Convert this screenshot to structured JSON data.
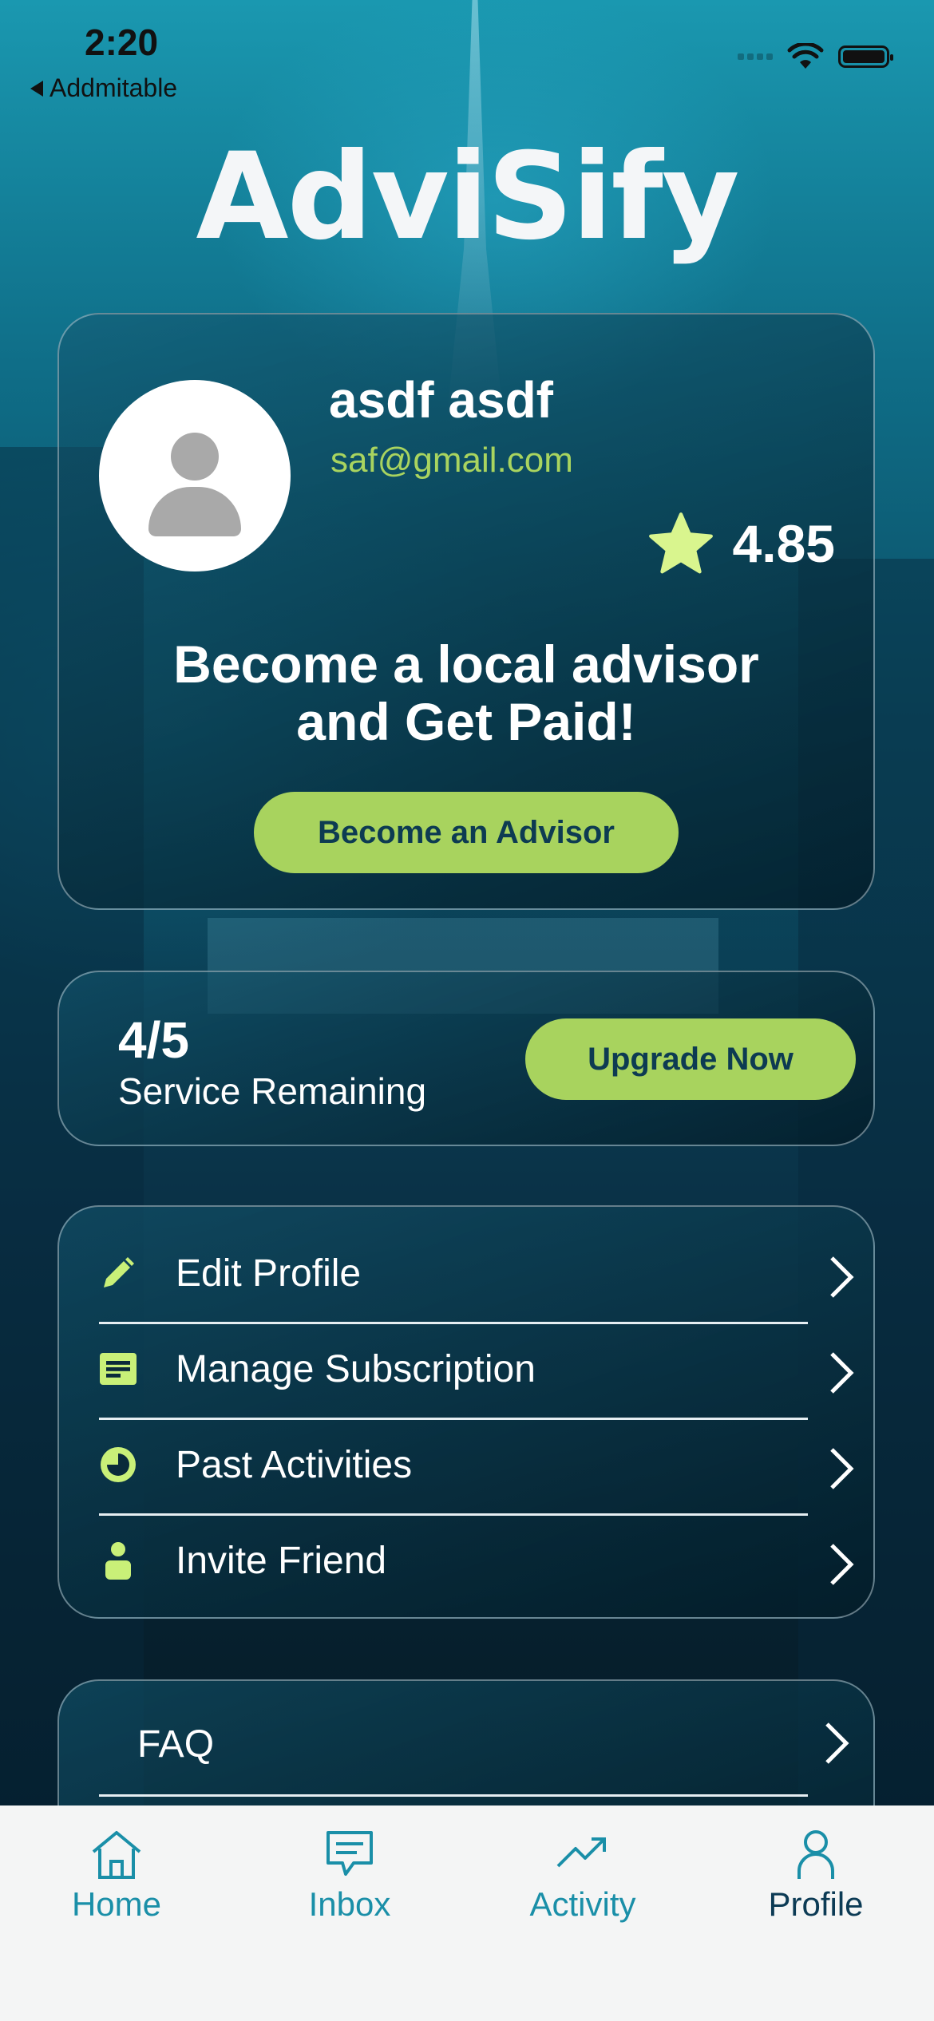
{
  "status_bar": {
    "time": "2:20",
    "back_label": "Addmitable"
  },
  "logo": {
    "text": "AdviSify"
  },
  "profile": {
    "name": "asdf asdf",
    "email": "saf@gmail.com",
    "rating": "4.85",
    "rating_icon": "star-icon",
    "promo_line1": "Become a local advisor",
    "promo_line2": "and Get Paid!",
    "become_button": "Become an Advisor"
  },
  "service": {
    "count": "4/5",
    "label": "Service Remaining",
    "upgrade_button": "Upgrade Now"
  },
  "menu": {
    "items": [
      {
        "label": "Edit Profile",
        "icon": "pencil-icon"
      },
      {
        "label": "Manage Subscription",
        "icon": "subscription-icon"
      },
      {
        "label": "Past Activities",
        "icon": "clock-icon"
      },
      {
        "label": "Invite Friend",
        "icon": "person-icon"
      }
    ]
  },
  "faq": {
    "label": "FAQ"
  },
  "tabbar": {
    "tabs": [
      {
        "label": "Home",
        "icon": "home-icon"
      },
      {
        "label": "Inbox",
        "icon": "chat-icon"
      },
      {
        "label": "Activity",
        "icon": "trend-icon"
      },
      {
        "label": "Profile",
        "icon": "person-icon",
        "active": true
      }
    ]
  },
  "colors": {
    "accent_green": "#a8d35e",
    "email_green": "#a9d45f",
    "tab_teal": "#1a8fa8",
    "tab_active": "#0c3b55"
  }
}
